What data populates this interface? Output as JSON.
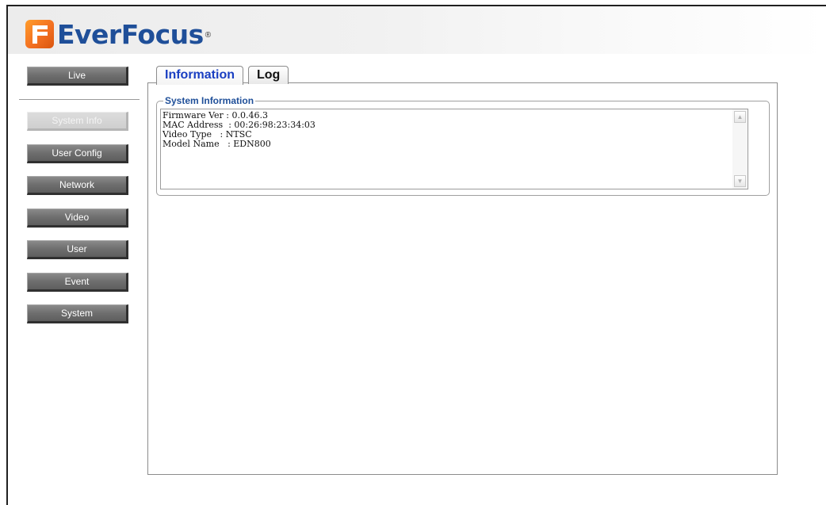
{
  "header": {
    "logo_text": "EverFocus",
    "logo_reg": "®"
  },
  "sidebar": {
    "items": [
      {
        "label": "Live"
      },
      {
        "label": "System Info",
        "active": true
      },
      {
        "label": "User Config"
      },
      {
        "label": "Network"
      },
      {
        "label": "Video"
      },
      {
        "label": "User"
      },
      {
        "label": "Event"
      },
      {
        "label": "System"
      }
    ]
  },
  "tabs": [
    {
      "label": "Information",
      "active": true
    },
    {
      "label": "Log"
    }
  ],
  "system_info": {
    "legend": "System Information",
    "lines": [
      "Firmware Ver : 0.0.46.3",
      "MAC Address  : 00:26:98:23:34:03",
      "Video Type   : NTSC",
      "Model Name   : EDN800"
    ]
  },
  "icons": {
    "scroll_up": "triangle-up-icon",
    "scroll_down": "triangle-down-icon"
  },
  "colors": {
    "brand_blue": "#1f4f99",
    "logo_orange": "#f37021",
    "active_tab_text": "#1a3fc2",
    "nav_button": "#6e6e6e"
  }
}
